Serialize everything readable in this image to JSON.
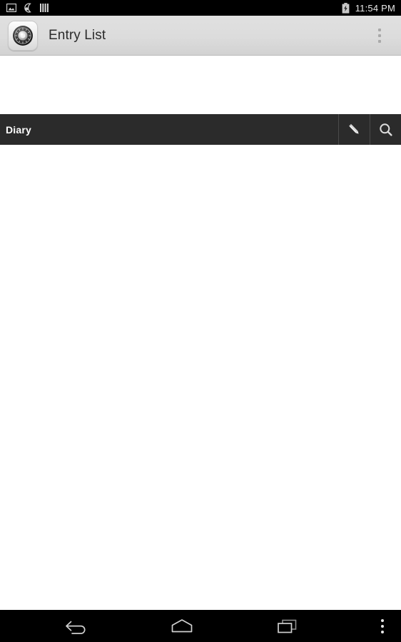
{
  "status_bar": {
    "background": "#000000",
    "clock": "11:54 PM",
    "left_icons": [
      {
        "name": "screenshot-icon",
        "label": "Screenshot"
      },
      {
        "name": "do-not-disturb-moon-icon",
        "label": "Do Not Disturb"
      },
      {
        "name": "equalizer-bars-icon",
        "label": "Equalizer"
      }
    ],
    "right_icons": [
      {
        "name": "battery-charging-icon",
        "label": "Battery Charging"
      }
    ]
  },
  "action_bar": {
    "background": "#dcdcdc",
    "app_icon": "vault-dial-icon",
    "title": "Entry List",
    "overflow": "overflow-menu-icon"
  },
  "section": {
    "background": "#2b2b2b",
    "title": "Diary",
    "actions": [
      {
        "name": "compose-pencil-icon",
        "label": "New Entry"
      },
      {
        "name": "search-icon",
        "label": "Search"
      }
    ]
  },
  "list": {
    "items": [],
    "empty": ""
  },
  "nav_bar": {
    "background": "#000000",
    "buttons": [
      {
        "name": "back-icon",
        "label": "Back"
      },
      {
        "name": "home-icon",
        "label": "Home"
      },
      {
        "name": "recents-icon",
        "label": "Recent Apps"
      },
      {
        "name": "nav-overflow-icon",
        "label": "Menu"
      }
    ]
  }
}
